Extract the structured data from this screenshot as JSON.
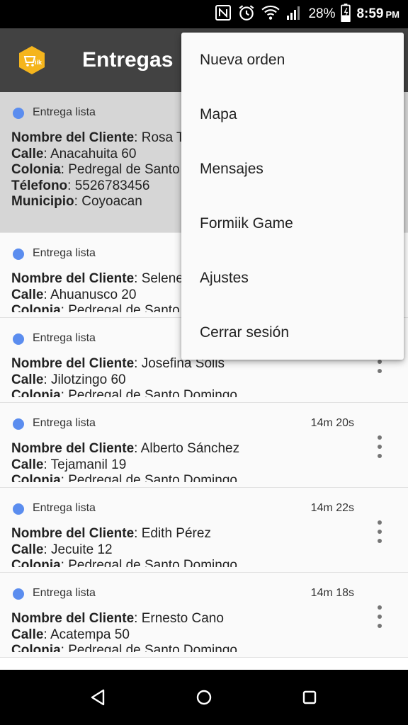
{
  "status_bar": {
    "battery": "28%",
    "time": "8:59",
    "ampm": "PM",
    "icons": [
      "nfc-icon",
      "alarm-icon",
      "wifi-icon",
      "signal-icon",
      "battery-charging-icon"
    ]
  },
  "app_bar": {
    "title": "Entregas",
    "logo_text": "iik"
  },
  "deliveries": [
    {
      "status": "Entrega lista",
      "elapsed": "",
      "fields": [
        {
          "label": "Nombre del Cliente",
          "value": "Rosa Tor"
        },
        {
          "label": "Calle",
          "value": "Anacahuita 60"
        },
        {
          "label": "Colonia",
          "value": "Pedregal de Santo D"
        },
        {
          "label": "Télefono",
          "value": "5526783456"
        },
        {
          "label": "Municipio",
          "value": "Coyoacan"
        }
      ]
    },
    {
      "status": "Entrega lista",
      "elapsed": "",
      "fields": [
        {
          "label": "Nombre del Cliente",
          "value": "Selene A"
        },
        {
          "label": "Calle",
          "value": "Ahuanusco 20"
        },
        {
          "label": "Colonia",
          "value": "Pedregal de Santo D"
        }
      ]
    },
    {
      "status": "Entrega lista",
      "elapsed": "",
      "fields": [
        {
          "label": "Nombre del Cliente",
          "value": "Josefina Sólis"
        },
        {
          "label": "Calle",
          "value": "Jilotzingo 60"
        },
        {
          "label": "Colonia",
          "value": "Pedregal de Santo Domingo"
        }
      ]
    },
    {
      "status": "Entrega lista",
      "elapsed": "14m 20s",
      "fields": [
        {
          "label": "Nombre del Cliente",
          "value": "Alberto Sánchez"
        },
        {
          "label": "Calle",
          "value": "Tejamanil 19"
        },
        {
          "label": "Colonia",
          "value": "Pedregal de Santo Domingo"
        }
      ]
    },
    {
      "status": "Entrega lista",
      "elapsed": "14m 22s",
      "fields": [
        {
          "label": "Nombre del Cliente",
          "value": "Edith Pérez"
        },
        {
          "label": "Calle",
          "value": "Jecuite 12"
        },
        {
          "label": "Colonia",
          "value": "Pedregal de Santo Domingo"
        }
      ]
    },
    {
      "status": "Entrega lista",
      "elapsed": "14m 18s",
      "fields": [
        {
          "label": "Nombre del Cliente",
          "value": "Ernesto Cano"
        },
        {
          "label": "Calle",
          "value": "Acatempa 50"
        },
        {
          "label": "Colonia",
          "value": "Pedregal de Santo Domingo"
        }
      ]
    }
  ],
  "menu": {
    "items": [
      "Nueva orden",
      "Mapa",
      "Mensajes",
      "Formiik Game",
      "Ajustes",
      "Cerrar sesión"
    ]
  },
  "colors": {
    "app_bar": "#424242",
    "status_dot": "#5b8def",
    "logo": "#f5b51d",
    "selected_row": "#d6d6d6"
  }
}
